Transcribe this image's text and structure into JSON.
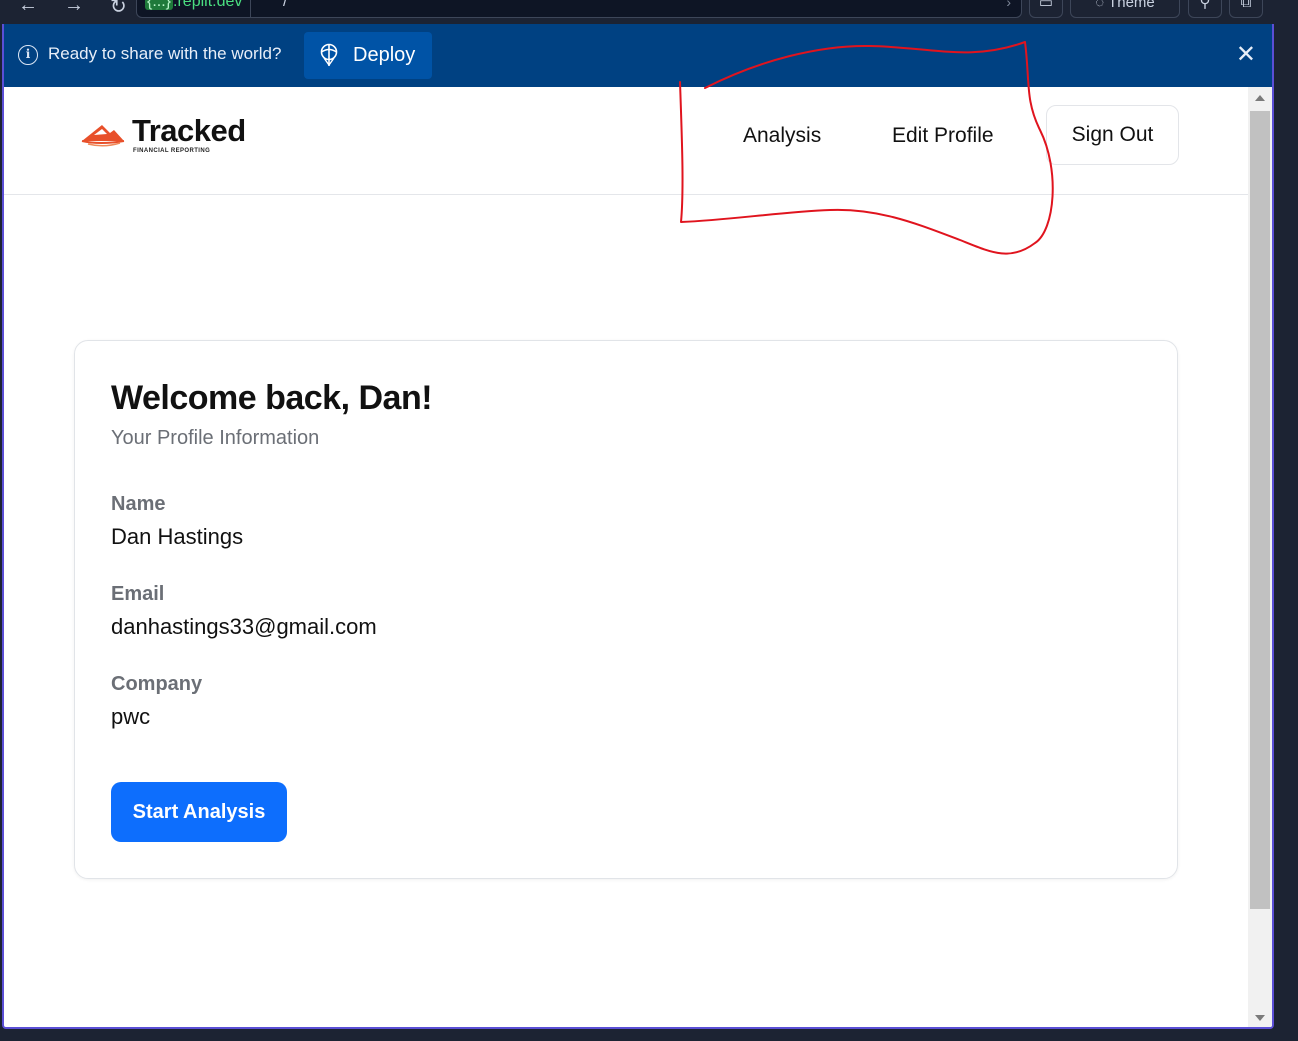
{
  "browser": {
    "host_badge": "{...}",
    "host": ".replit.dev",
    "path": "/",
    "theme_label": "Theme"
  },
  "banner": {
    "message": "Ready to share with the world?",
    "deploy_label": "Deploy"
  },
  "header": {
    "brand": "Tracked",
    "brand_sub": "FINANCIAL REPORTING",
    "nav": {
      "analysis": "Analysis",
      "edit_profile": "Edit Profile",
      "sign_out": "Sign Out"
    }
  },
  "profile": {
    "welcome": "Welcome back, Dan!",
    "subtitle": "Your Profile Information",
    "name_label": "Name",
    "name": "Dan Hastings",
    "email_label": "Email",
    "email": "danhastings33@gmail.com",
    "company_label": "Company",
    "company": "pwc",
    "start_button": "Start Analysis"
  },
  "colors": {
    "banner_bg": "#004182",
    "primary_button": "#0d6efd",
    "annotation": "#e0141e",
    "frame_border": "#5b4fd6"
  }
}
